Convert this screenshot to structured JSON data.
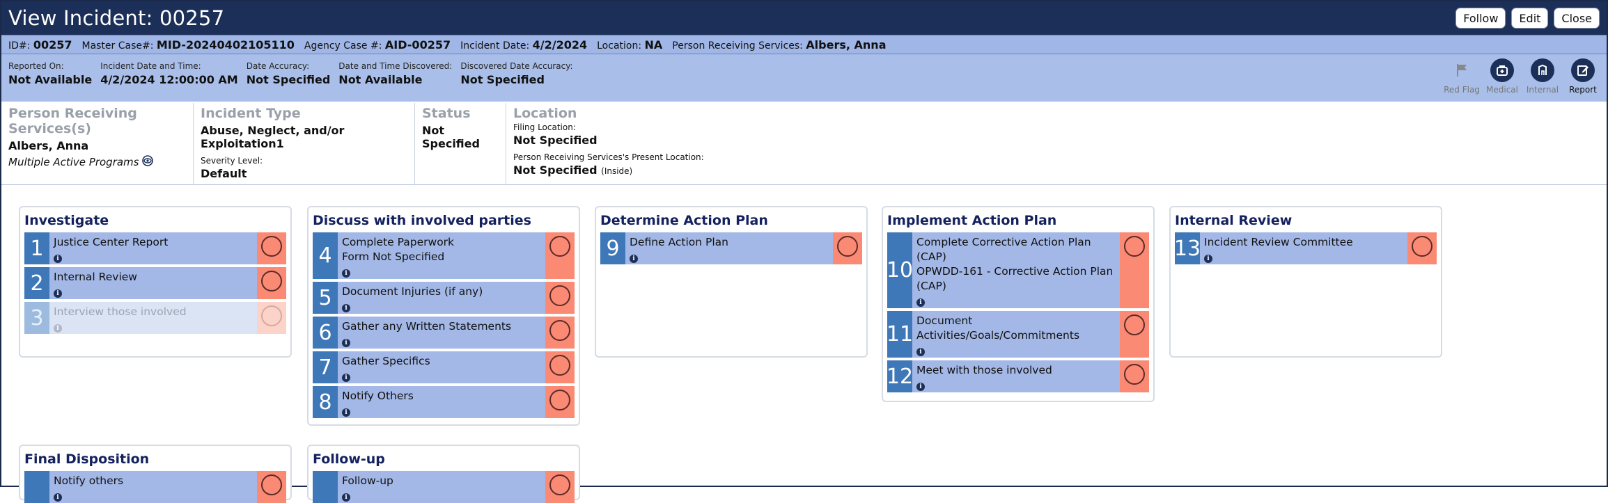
{
  "window": {
    "title": "View Incident: 00257",
    "buttons": {
      "follow": "Follow",
      "edit": "Edit",
      "close": "Close"
    }
  },
  "id_bar": {
    "id_label": "ID#:",
    "id_value": "00257",
    "master_label": "Master Case#:",
    "master_value": "MID-20240402105110",
    "agency_label": "Agency Case #:",
    "agency_value": "AID-00257",
    "date_label": "Incident Date:",
    "date_value": "4/2/2024",
    "location_label": "Location:",
    "location_value": "NA",
    "person_label": "Person Receiving Services:",
    "person_value": "Albers, Anna"
  },
  "meta": {
    "reported_on": {
      "label": "Reported On:",
      "value": "Not Available"
    },
    "incident_dt": {
      "label": "Incident Date and Time:",
      "value": "4/2/2024 12:00:00 AM"
    },
    "date_accuracy": {
      "label": "Date Accuracy:",
      "value": "Not Specified"
    },
    "date_discovered": {
      "label": "Date and Time Discovered:",
      "value": "Not Available"
    },
    "discovered_accuracy": {
      "label": "Discovered Date Accuracy:",
      "value": "Not Specified"
    },
    "tools": [
      {
        "label": "Red Flag",
        "icon": "flag-icon",
        "enabled": false
      },
      {
        "label": "Medical",
        "icon": "medical-bag-icon",
        "enabled": false
      },
      {
        "label": "Internal",
        "icon": "building-icon",
        "enabled": false
      },
      {
        "label": "Report",
        "icon": "edit-report-icon",
        "enabled": true
      }
    ]
  },
  "summary": {
    "person": {
      "heading": "Person Receiving Services(s)",
      "name": "Albers, Anna",
      "programs": "Multiple Active Programs"
    },
    "incident_type": {
      "heading": "Incident Type",
      "value": "Abuse, Neglect, and/or Exploitation1",
      "severity_label": "Severity Level:",
      "severity_value": "Default"
    },
    "status": {
      "heading": "Status",
      "value": "Not Specified"
    },
    "location": {
      "heading": "Location",
      "filing_label": "Filing Location:",
      "filing_value": "Not Specified",
      "present_label": "Person Receiving Services's Present Location:",
      "present_value": "Not Specified",
      "present_note": "(Inside)"
    }
  },
  "columns": [
    {
      "title": "Investigate",
      "steps": [
        {
          "num": "1",
          "lines": [
            "Justice Center Report"
          ],
          "faded": false
        },
        {
          "num": "2",
          "lines": [
            "Internal Review"
          ],
          "faded": false
        },
        {
          "num": "3",
          "lines": [
            "Interview those involved"
          ],
          "faded": true
        }
      ]
    },
    {
      "title": "Discuss with involved parties",
      "steps": [
        {
          "num": "4",
          "lines": [
            "Complete Paperwork",
            "Form Not Specified"
          ],
          "faded": false
        },
        {
          "num": "5",
          "lines": [
            "Document Injuries (if any)"
          ],
          "faded": false
        },
        {
          "num": "6",
          "lines": [
            "Gather any Written Statements"
          ],
          "faded": false
        },
        {
          "num": "7",
          "lines": [
            "Gather Specifics"
          ],
          "faded": false
        },
        {
          "num": "8",
          "lines": [
            "Notify Others"
          ],
          "faded": false
        }
      ]
    },
    {
      "title": "Determine Action Plan",
      "steps": [
        {
          "num": "9",
          "lines": [
            "Define Action Plan"
          ],
          "faded": false
        }
      ]
    },
    {
      "title": "Implement Action Plan",
      "steps": [
        {
          "num": "10",
          "lines": [
            "Complete Corrective Action Plan",
            "(CAP)",
            "OPWDD-161 - Corrective Action Plan",
            "(CAP)"
          ],
          "faded": false
        },
        {
          "num": "11",
          "lines": [
            "Document",
            "Activities/Goals/Commitments"
          ],
          "faded": false
        },
        {
          "num": "12",
          "lines": [
            "Meet with those involved"
          ],
          "faded": false
        }
      ]
    },
    {
      "title": "Internal Review",
      "steps": [
        {
          "num": "13",
          "lines": [
            "Incident Review Committee"
          ],
          "faded": false
        }
      ]
    },
    {
      "title": "Final Disposition",
      "steps": [
        {
          "num": "",
          "lines": [
            "Notify others"
          ],
          "faded": false
        }
      ]
    },
    {
      "title": "Follow-up",
      "steps": [
        {
          "num": "",
          "lines": [
            "Follow-up"
          ],
          "faded": false
        }
      ]
    }
  ],
  "colors": {
    "titlebar": "#1c2f58",
    "idbar": "#9fb6e6",
    "step_bg": "#a3b8e7",
    "step_num": "#3f78b8",
    "status_cell": "#fa8a73",
    "card_title": "#13215e"
  }
}
